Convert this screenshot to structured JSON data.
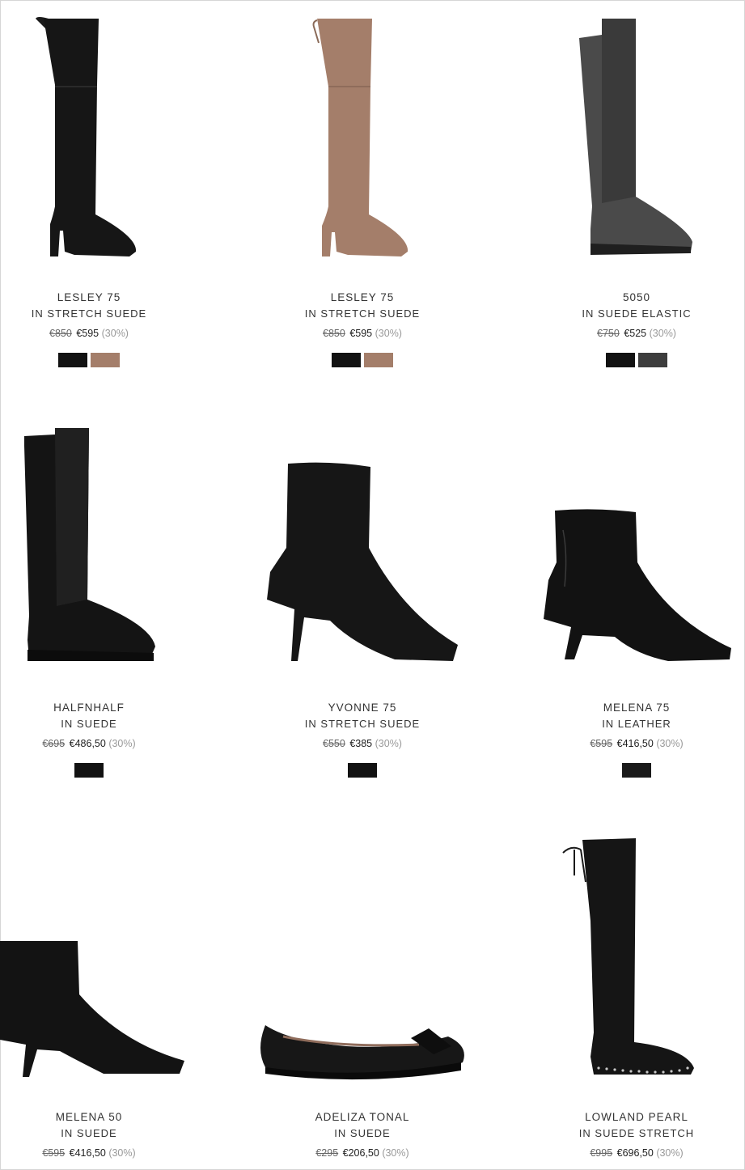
{
  "colors": {
    "black": "#121212",
    "taupe": "#a47e6a",
    "grey": "#3d3d3d",
    "black_leather": "#1a1a1a"
  },
  "products": [
    {
      "name": "LESLEY 75",
      "subtitle": "IN STRETCH SUEDE",
      "old_price": "€850",
      "price": "€595",
      "discount": "(30%)",
      "image": "black-over-knee-boot-icon",
      "swatches": [
        "#121212",
        "#a47e6a"
      ]
    },
    {
      "name": "LESLEY 75",
      "subtitle": "IN STRETCH SUEDE",
      "old_price": "€850",
      "price": "€595",
      "discount": "(30%)",
      "image": "taupe-over-knee-boot-icon",
      "swatches": [
        "#121212",
        "#a47e6a"
      ]
    },
    {
      "name": "5050",
      "subtitle": "IN SUEDE ELASTIC",
      "old_price": "€750",
      "price": "€525",
      "discount": "(30%)",
      "image": "grey-flat-over-knee-boot-icon",
      "swatches": [
        "#121212",
        "#3d3d3d"
      ]
    },
    {
      "name": "HALFNHALF",
      "subtitle": "IN SUEDE",
      "old_price": "€695",
      "price": "€486,50",
      "discount": "(30%)",
      "image": "black-knee-boot-icon",
      "swatches": [
        "#121212"
      ]
    },
    {
      "name": "YVONNE 75",
      "subtitle": "IN STRETCH SUEDE",
      "old_price": "€550",
      "price": "€385",
      "discount": "(30%)",
      "image": "black-sock-bootie-icon",
      "swatches": [
        "#121212"
      ]
    },
    {
      "name": "MELENA 75",
      "subtitle": "IN LEATHER",
      "old_price": "€595",
      "price": "€416,50",
      "discount": "(30%)",
      "image": "black-leather-ankle-boot-icon",
      "swatches": [
        "#1a1a1a"
      ]
    },
    {
      "name": "MELENA 50",
      "subtitle": "IN SUEDE",
      "old_price": "€595",
      "price": "€416,50",
      "discount": "(30%)",
      "image": "black-kitten-heel-bootie-icon",
      "swatches": []
    },
    {
      "name": "ADELIZA TONAL",
      "subtitle": "IN SUEDE",
      "old_price": "€295",
      "price": "€206,50",
      "discount": "(30%)",
      "image": "black-ballet-flat-icon",
      "swatches": []
    },
    {
      "name": "LOWLAND PEARL",
      "subtitle": "IN SUEDE STRETCH",
      "old_price": "€995",
      "price": "€696,50",
      "discount": "(30%)",
      "image": "black-pearl-over-knee-boot-icon",
      "swatches": []
    }
  ]
}
